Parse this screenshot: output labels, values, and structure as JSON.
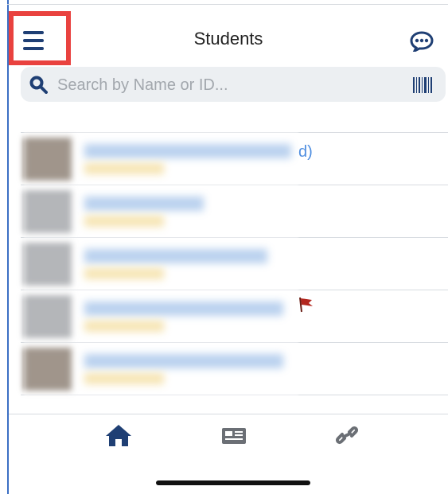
{
  "header": {
    "title": "Students"
  },
  "search": {
    "placeholder": "Search by Name or ID..."
  },
  "list": {
    "visible_suffix": "d)"
  },
  "icons": {
    "menu": "hamburger-menu-icon",
    "chat": "chat-bubble-icon",
    "search": "search-icon",
    "barcode": "barcode-icon",
    "flag": "flag-icon",
    "home": "home-icon",
    "news": "newspaper-icon",
    "link": "link-icon"
  },
  "colors": {
    "brand": "#1f3f74",
    "highlight": "#e9423f",
    "link_blue": "#4f8ee0"
  }
}
